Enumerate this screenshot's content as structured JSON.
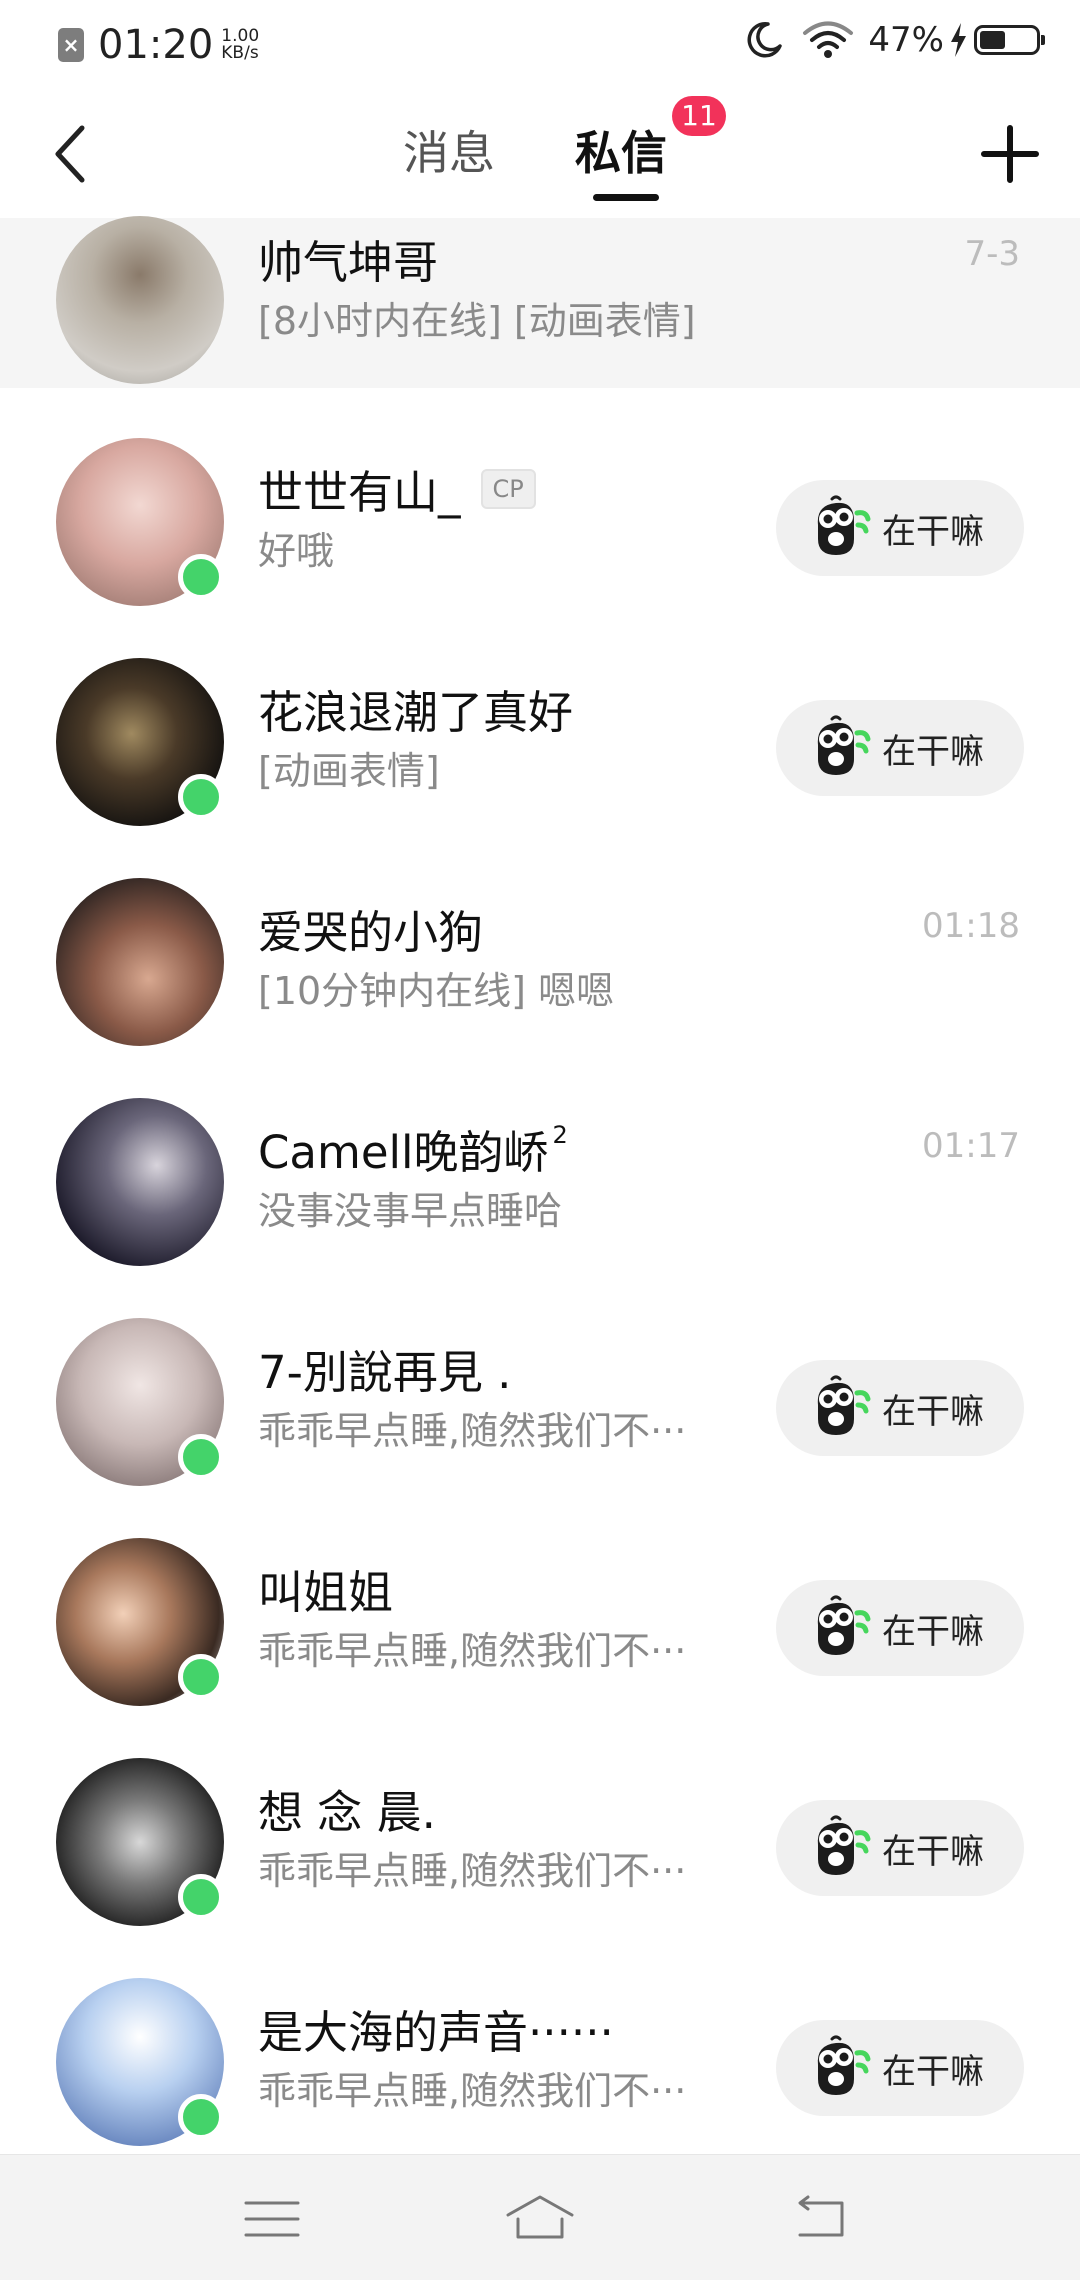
{
  "status_bar": {
    "time": "01:20",
    "speed_value": "1.00",
    "speed_unit": "KB/s",
    "battery_percent": "47%",
    "battery_level": 0.47
  },
  "header": {
    "tabs": [
      {
        "label": "消息"
      },
      {
        "label": "私信"
      }
    ],
    "active_tab": "私信",
    "unread_badge": "11"
  },
  "conversations": [
    {
      "name": "帅气坤哥",
      "preview": "[8小时内在线] [动画表情]",
      "time": "7-3",
      "online": false,
      "pinned": true,
      "avatar": "child-photo"
    },
    {
      "name": "世世有山_",
      "tag": "CP",
      "preview": "好哦",
      "time": "",
      "online": true,
      "action": "在干嘛",
      "avatar": "girl-selfie"
    },
    {
      "name": "花浪退潮了真好",
      "preview": "[动画表情]",
      "time": "",
      "online": true,
      "action": "在干嘛",
      "avatar": "night-photo"
    },
    {
      "name": "爱哭的小狗",
      "preview": "[10分钟内在线] 嗯嗯",
      "time": "01:18",
      "online": false,
      "avatar": "boy-selfie"
    },
    {
      "name": "Camell晚韵峤",
      "superscript": "2",
      "preview": "没事没事早点睡哈",
      "time": "01:17",
      "online": false,
      "avatar": "dark-portrait"
    },
    {
      "name": "7-別說再見 .",
      "preview": "乖乖早点睡,随然我们不···",
      "time": "",
      "online": true,
      "action": "在干嘛",
      "avatar": "girl-portrait"
    },
    {
      "name": "叫姐姐",
      "preview": "乖乖早点睡,随然我们不···",
      "time": "",
      "online": true,
      "action": "在干嘛",
      "avatar": "cartoon-girl"
    },
    {
      "name": "想 念 晨.",
      "preview": "乖乖早点睡,随然我们不···",
      "time": "",
      "online": true,
      "action": "在干嘛",
      "avatar": "bw-portrait"
    },
    {
      "name": "是大海的声音······",
      "preview": "乖乖早点睡,随然我们不···",
      "time": "",
      "online": true,
      "action": "在干嘛",
      "avatar": "sky-photo"
    }
  ],
  "colors": {
    "badge": "#f2325a",
    "online": "#44d36a",
    "wave_icon_accent": "#46d65c"
  },
  "nav_bar": {
    "icons": [
      "menu-icon",
      "home-icon",
      "back-icon"
    ]
  }
}
